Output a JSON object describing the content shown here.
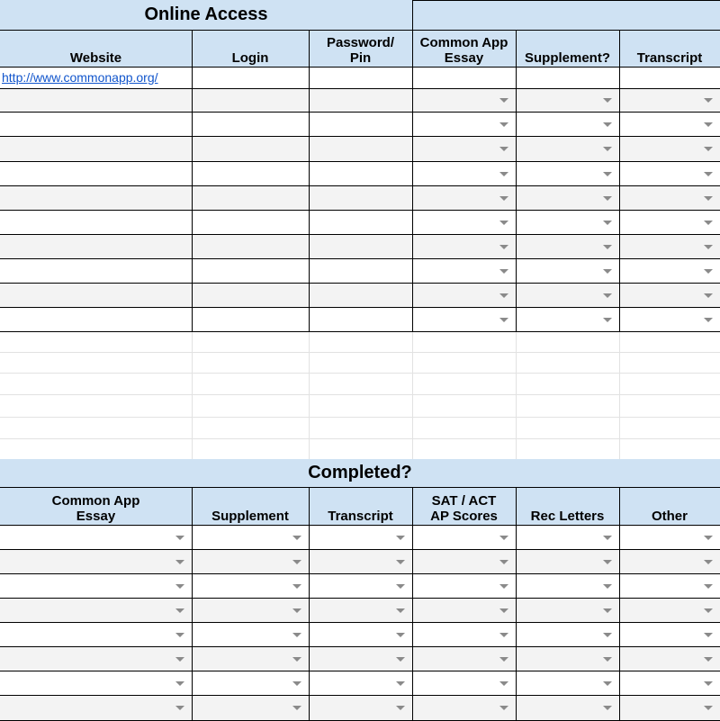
{
  "online_access": {
    "title": "Online Access",
    "headers": [
      "Website",
      "Login",
      "Password/\nPin",
      "Common App\nEssay",
      "Supplement?",
      "Transcript"
    ],
    "rows": [
      [
        "http://www.commonapp.org/",
        "",
        "",
        "",
        "",
        ""
      ],
      [
        "",
        "",
        "",
        "",
        "",
        ""
      ],
      [
        "",
        "",
        "",
        "",
        "",
        ""
      ],
      [
        "",
        "",
        "",
        "",
        "",
        ""
      ],
      [
        "",
        "",
        "",
        "",
        "",
        ""
      ],
      [
        "",
        "",
        "",
        "",
        "",
        ""
      ],
      [
        "",
        "",
        "",
        "",
        "",
        ""
      ],
      [
        "",
        "",
        "",
        "",
        "",
        ""
      ],
      [
        "",
        "",
        "",
        "",
        "",
        ""
      ],
      [
        "",
        "",
        "",
        "",
        "",
        ""
      ],
      [
        "",
        "",
        "",
        "",
        "",
        ""
      ]
    ]
  },
  "completed": {
    "title": "Completed?",
    "headers": [
      "Common App\nEssay",
      "Supplement",
      "Transcript",
      "SAT / ACT\nAP Scores",
      "Rec Letters",
      "Other"
    ],
    "rows": [
      [
        "",
        "",
        "",
        "",
        "",
        ""
      ],
      [
        "",
        "",
        "",
        "",
        "",
        ""
      ],
      [
        "",
        "",
        "",
        "",
        "",
        ""
      ],
      [
        "",
        "",
        "",
        "",
        "",
        ""
      ],
      [
        "",
        "",
        "",
        "",
        "",
        ""
      ],
      [
        "",
        "",
        "",
        "",
        "",
        ""
      ],
      [
        "",
        "",
        "",
        "",
        "",
        ""
      ],
      [
        "",
        "",
        "",
        "",
        "",
        ""
      ]
    ]
  },
  "colors": {
    "header_fill": "#cfe2f3",
    "band_fill": "#f3f3f3",
    "link": "#1155cc",
    "border": "#000000",
    "gridline": "#e2e2e2"
  },
  "icons": {
    "dropdown": "chevron-down-icon"
  }
}
